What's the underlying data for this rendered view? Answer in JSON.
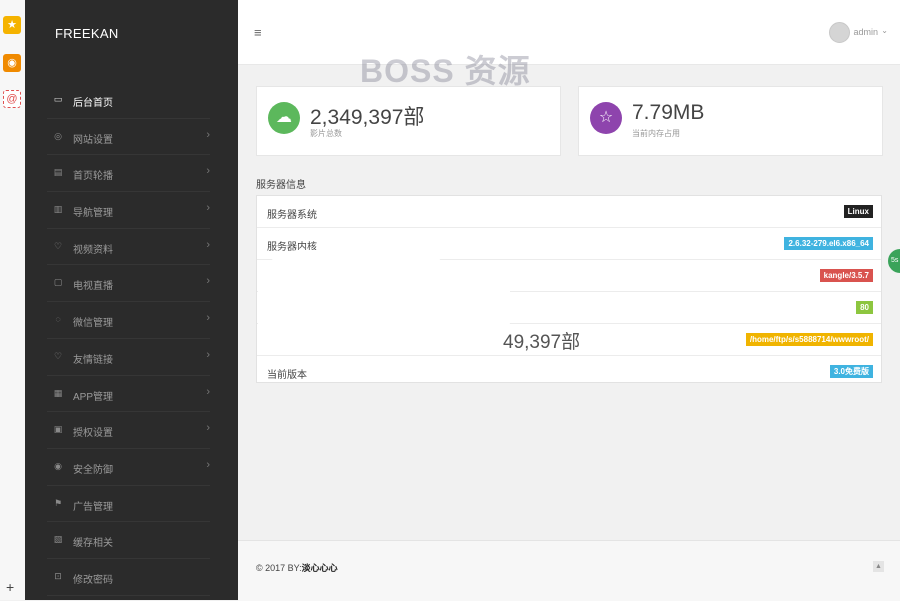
{
  "brand": "FREEKAN",
  "watermark": "BOSS 资源",
  "header": {
    "menu_icon": "≡",
    "username": "admin"
  },
  "sidebar": {
    "items": [
      {
        "label": "后台首页",
        "icon": "monitor-icon",
        "arrow": false,
        "active": true
      },
      {
        "label": "网站设置",
        "icon": "globe-icon",
        "arrow": true
      },
      {
        "label": "首页轮播",
        "icon": "document-icon",
        "arrow": true
      },
      {
        "label": "导航管理",
        "icon": "columns-icon",
        "arrow": true
      },
      {
        "label": "视频资料",
        "icon": "heart-icon",
        "arrow": true
      },
      {
        "label": "电视直播",
        "icon": "tv-icon",
        "arrow": true
      },
      {
        "label": "微信管理",
        "icon": "chat-icon",
        "arrow": true
      },
      {
        "label": "友情链接",
        "icon": "heart-icon",
        "arrow": true
      },
      {
        "label": "APP管理",
        "icon": "app-icon",
        "arrow": true
      },
      {
        "label": "授权设置",
        "icon": "license-icon",
        "arrow": true
      },
      {
        "label": "安全防御",
        "icon": "eye-icon",
        "arrow": true
      },
      {
        "label": "广告管理",
        "icon": "ad-icon",
        "arrow": false
      },
      {
        "label": "缓存相关",
        "icon": "cache-icon",
        "arrow": false
      },
      {
        "label": "修改密码",
        "icon": "lock-icon",
        "arrow": false
      }
    ]
  },
  "stats": [
    {
      "value": "2,349,397部",
      "caption": "影片总数",
      "color": "#5cb85c",
      "icon": "cloud-icon"
    },
    {
      "value": "7.79MB",
      "caption": "当前内存占用",
      "color": "#8e44ad",
      "icon": "star-icon"
    }
  ],
  "server": {
    "title": "服务器信息",
    "rows": [
      {
        "label": "服务器系统",
        "value": "Linux",
        "color": "#222222"
      },
      {
        "label": "服务器内核",
        "value": "2.6.32-279.el6.x86_64",
        "color": "#3fb3e0"
      },
      {
        "label": "",
        "value": "kangle/3.5.7",
        "color": "#d9534f"
      },
      {
        "label": "",
        "value": "80",
        "color": "#8dc63f"
      },
      {
        "label": "",
        "value": "/home/ftp/s/s5888714/wwwroot/",
        "color": "#f0b400"
      },
      {
        "label": "当前版本",
        "value": "3.0免费版",
        "color": "#3fb3e0"
      }
    ],
    "ghost_text": "49,397部"
  },
  "footer": {
    "copyright": "© 2017 BY:",
    "author": "淡心心心"
  }
}
